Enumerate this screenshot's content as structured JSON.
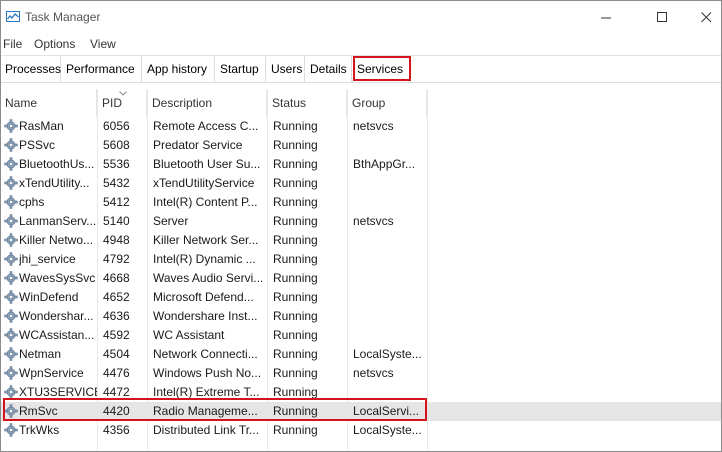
{
  "window": {
    "title": "Task Manager"
  },
  "menu": {
    "file": "File",
    "options": "Options",
    "view": "View"
  },
  "tabs": [
    {
      "label": "Processes"
    },
    {
      "label": "Performance"
    },
    {
      "label": "App history"
    },
    {
      "label": "Startup"
    },
    {
      "label": "Users"
    },
    {
      "label": "Details"
    },
    {
      "label": "Services"
    }
  ],
  "active_tab": "Services",
  "columns": {
    "name": "Name",
    "pid": "PID",
    "description": "Description",
    "status": "Status",
    "group": "Group"
  },
  "rows": [
    {
      "name": "RasMan",
      "pid": "6056",
      "description": "Remote Access C...",
      "status": "Running",
      "group": "netsvcs"
    },
    {
      "name": "PSSvc",
      "pid": "5608",
      "description": "Predator Service",
      "status": "Running",
      "group": ""
    },
    {
      "name": "BluetoothUs...",
      "pid": "5536",
      "description": "Bluetooth User Su...",
      "status": "Running",
      "group": "BthAppGr..."
    },
    {
      "name": "xTendUtility...",
      "pid": "5432",
      "description": "xTendUtilityService",
      "status": "Running",
      "group": ""
    },
    {
      "name": "cphs",
      "pid": "5412",
      "description": "Intel(R) Content P...",
      "status": "Running",
      "group": ""
    },
    {
      "name": "LanmanServ...",
      "pid": "5140",
      "description": "Server",
      "status": "Running",
      "group": "netsvcs"
    },
    {
      "name": "Killer Netwo...",
      "pid": "4948",
      "description": "Killer Network Ser...",
      "status": "Running",
      "group": ""
    },
    {
      "name": "jhi_service",
      "pid": "4792",
      "description": "Intel(R) Dynamic ...",
      "status": "Running",
      "group": ""
    },
    {
      "name": "WavesSysSvc",
      "pid": "4668",
      "description": "Waves Audio Servi...",
      "status": "Running",
      "group": ""
    },
    {
      "name": "WinDefend",
      "pid": "4652",
      "description": "Microsoft Defend...",
      "status": "Running",
      "group": ""
    },
    {
      "name": "Wondershar...",
      "pid": "4636",
      "description": "Wondershare Inst...",
      "status": "Running",
      "group": ""
    },
    {
      "name": "WCAssistan...",
      "pid": "4592",
      "description": "WC Assistant",
      "status": "Running",
      "group": ""
    },
    {
      "name": "Netman",
      "pid": "4504",
      "description": "Network Connecti...",
      "status": "Running",
      "group": "LocalSyste..."
    },
    {
      "name": "WpnService",
      "pid": "4476",
      "description": "Windows Push No...",
      "status": "Running",
      "group": "netsvcs"
    },
    {
      "name": "XTU3SERVICE",
      "pid": "4472",
      "description": "Intel(R) Extreme T...",
      "status": "Running",
      "group": ""
    },
    {
      "name": "RmSvc",
      "pid": "4420",
      "description": "Radio Manageme...",
      "status": "Running",
      "group": "LocalServi..."
    },
    {
      "name": "TrkWks",
      "pid": "4356",
      "description": "Distributed Link Tr...",
      "status": "Running",
      "group": "LocalSyste..."
    }
  ],
  "selected_row": "RmSvc",
  "colors": {
    "highlight_border": "#d1141d",
    "selected_row_bg": "#e5e5e5"
  }
}
